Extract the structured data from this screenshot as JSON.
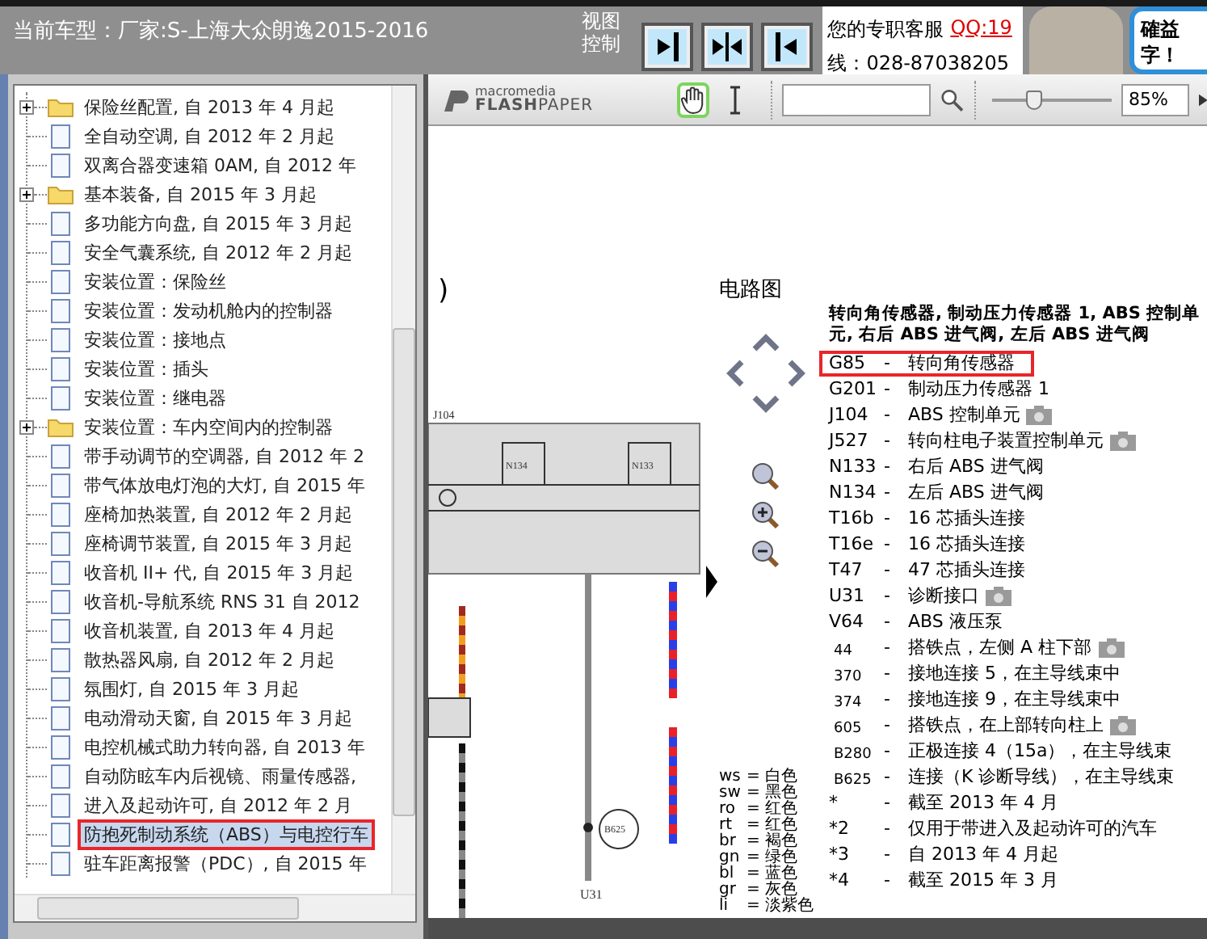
{
  "top_bar": {
    "vehicle": "当前车型：厂家:S-上海大众朗逸2015-2016",
    "view_control_label": "视图控制",
    "view_buttons": [
      {
        "kind": "right"
      },
      {
        "kind": "both"
      },
      {
        "kind": "left"
      }
    ],
    "service": {
      "label": "您的专职客服",
      "qq": "QQ:19",
      "phone": "线：028-87038205"
    },
    "promo": [
      "確益",
      "字！"
    ]
  },
  "tree": {
    "items": [
      {
        "label": "保险丝配置, 自 2013 年 4 月起",
        "kind": "folder",
        "expanded": false,
        "selected": false,
        "highlighted": false
      },
      {
        "label": "全自动空调, 自 2012 年 2 月起",
        "kind": "page",
        "selected": false,
        "highlighted": false
      },
      {
        "label": "双离合器变速箱 0AM, 自 2012 年",
        "kind": "page",
        "selected": false,
        "highlighted": false
      },
      {
        "label": "基本装备, 自 2015 年 3 月起",
        "kind": "folder",
        "expanded": false,
        "selected": false,
        "highlighted": false
      },
      {
        "label": "多功能方向盘, 自 2015 年 3 月起",
        "kind": "page",
        "selected": false,
        "highlighted": false
      },
      {
        "label": "安全气囊系统, 自 2012 年 2 月起",
        "kind": "page",
        "selected": false,
        "highlighted": false
      },
      {
        "label": "安装位置：保险丝",
        "kind": "page",
        "selected": false,
        "highlighted": false
      },
      {
        "label": "安装位置：发动机舱内的控制器",
        "kind": "page",
        "selected": false,
        "highlighted": false
      },
      {
        "label": "安装位置：接地点",
        "kind": "page",
        "selected": false,
        "highlighted": false
      },
      {
        "label": "安装位置：插头",
        "kind": "page",
        "selected": false,
        "highlighted": false
      },
      {
        "label": "安装位置：继电器",
        "kind": "page",
        "selected": false,
        "highlighted": false
      },
      {
        "label": "安装位置：车内空间内的控制器",
        "kind": "folder",
        "expanded": false,
        "selected": false,
        "highlighted": false
      },
      {
        "label": "带手动调节的空调器, 自 2012 年 2",
        "kind": "page",
        "selected": false,
        "highlighted": false
      },
      {
        "label": "带气体放电灯泡的大灯, 自 2015 年",
        "kind": "page",
        "selected": false,
        "highlighted": false
      },
      {
        "label": "座椅加热装置, 自 2012 年 2 月起",
        "kind": "page",
        "selected": false,
        "highlighted": false
      },
      {
        "label": "座椅调节装置, 自 2015 年 3 月起",
        "kind": "page",
        "selected": false,
        "highlighted": false
      },
      {
        "label": "收音机 II+ 代, 自 2015 年 3 月起",
        "kind": "page",
        "selected": false,
        "highlighted": false
      },
      {
        "label": "收音机-导航系统 RNS 31 自 2012",
        "kind": "page",
        "selected": false,
        "highlighted": false
      },
      {
        "label": "收音机装置, 自 2013 年 4 月起",
        "kind": "page",
        "selected": false,
        "highlighted": false
      },
      {
        "label": "散热器风扇, 自 2012 年 2 月起",
        "kind": "page",
        "selected": false,
        "highlighted": false
      },
      {
        "label": "氛围灯, 自 2015 年 3 月起",
        "kind": "page",
        "selected": false,
        "highlighted": false
      },
      {
        "label": "电动滑动天窗, 自 2015 年 3 月起",
        "kind": "page",
        "selected": false,
        "highlighted": false
      },
      {
        "label": "电控机械式助力转向器, 自 2013 年",
        "kind": "page",
        "selected": false,
        "highlighted": false
      },
      {
        "label": "自动防眩车内后视镜、雨量传感器,",
        "kind": "page",
        "selected": false,
        "highlighted": false
      },
      {
        "label": "进入及起动许可, 自 2012 年 2 月",
        "kind": "page",
        "selected": false,
        "highlighted": false
      },
      {
        "label": "防抱死制动系统（ABS）与电控行车",
        "kind": "page",
        "selected": true,
        "highlighted": true
      },
      {
        "label": "驻车距离报警（PDC）, 自 2015 年",
        "kind": "page",
        "selected": false,
        "highlighted": false
      }
    ]
  },
  "viewer": {
    "logo_top": "macromedia",
    "logo": "**FLASH**PAPER",
    "tools": [
      {
        "kind": "hand",
        "selected": true
      },
      {
        "kind": "text",
        "selected": false
      }
    ],
    "zoom": {
      "level": 0.3,
      "value": "85%"
    },
    "page": {
      "bracket": ")",
      "title": "电路图",
      "heading": "转向角传感器, 制动压力传感器 1, ABS 控制单元, 右后 ABS 进气阀, 左后 ABS 进气阀",
      "diagram_labels": [
        "J104",
        "N134",
        "N133",
        "B625",
        "U31"
      ],
      "color_codes": [
        {
          "code": "ws",
          "sep": "=",
          "name": "白色"
        },
        {
          "code": "sw",
          "sep": "=",
          "name": "黑色"
        },
        {
          "code": "ro",
          "sep": "=",
          "name": "红色"
        },
        {
          "code": "rt",
          "sep": "=",
          "name": "红色"
        },
        {
          "code": "br",
          "sep": "=",
          "name": "褐色"
        },
        {
          "code": "gn",
          "sep": "=",
          "name": "绿色"
        },
        {
          "code": "bl",
          "sep": "=",
          "name": "蓝色"
        },
        {
          "code": "gr",
          "sep": "=",
          "name": "灰色"
        },
        {
          "code": "li",
          "sep": "=",
          "name": "淡紫色"
        }
      ],
      "legend": [
        {
          "kind": "part",
          "code": "G85",
          "sep": "-",
          "text": "转向角传感器",
          "camera": false,
          "highlighted": true
        },
        {
          "kind": "part",
          "code": "G201",
          "sep": "-",
          "text": "制动压力传感器 1",
          "camera": false,
          "highlighted": false
        },
        {
          "kind": "part",
          "code": "J104",
          "sep": "-",
          "text": "ABS 控制单元",
          "camera": true,
          "highlighted": false
        },
        {
          "kind": "part",
          "code": "J527",
          "sep": "-",
          "text": "转向柱电子装置控制单元",
          "camera": true,
          "highlighted": false
        },
        {
          "kind": "part",
          "code": "N133",
          "sep": "-",
          "text": "右后 ABS 进气阀",
          "camera": false,
          "highlighted": false
        },
        {
          "kind": "part",
          "code": "N134",
          "sep": "-",
          "text": "左后 ABS 进气阀",
          "camera": false,
          "highlighted": false
        },
        {
          "kind": "part",
          "code": "T16b",
          "sep": "-",
          "text": "16 芯插头连接",
          "camera": false,
          "highlighted": false
        },
        {
          "kind": "part",
          "code": "T16e",
          "sep": "-",
          "text": "16 芯插头连接",
          "camera": false,
          "highlighted": false
        },
        {
          "kind": "part",
          "code": "T47",
          "sep": "-",
          "text": "47 芯插头连接",
          "camera": false,
          "highlighted": false
        },
        {
          "kind": "part",
          "code": "U31",
          "sep": "-",
          "text": "诊断接口",
          "camera": true,
          "highlighted": false
        },
        {
          "kind": "part",
          "code": "V64",
          "sep": "-",
          "text": "ABS 液压泵",
          "camera": false,
          "highlighted": false
        },
        {
          "kind": "point",
          "code": "44",
          "sep": "-",
          "text": "搭铁点，左侧 A 柱下部",
          "camera": true,
          "highlighted": false
        },
        {
          "kind": "point",
          "code": "370",
          "sep": "-",
          "text": "接地连接 5，在主导线束中",
          "camera": false,
          "highlighted": false
        },
        {
          "kind": "point",
          "code": "374",
          "sep": "-",
          "text": "接地连接 9，在主导线束中",
          "camera": false,
          "highlighted": false
        },
        {
          "kind": "point",
          "code": "605",
          "sep": "-",
          "text": "搭铁点，在上部转向柱上",
          "camera": true,
          "highlighted": false
        },
        {
          "kind": "point",
          "code": "B280",
          "sep": "-",
          "text": "正极连接 4（15a），在主导线束",
          "camera": false,
          "highlighted": false
        },
        {
          "kind": "point",
          "code": "B625",
          "sep": "-",
          "text": "连接（K 诊断导线），在主导线束",
          "camera": false,
          "highlighted": false
        },
        {
          "kind": "part",
          "code": "*",
          "sep": "-",
          "text": "截至 2013 年 4 月",
          "camera": false,
          "highlighted": false
        },
        {
          "kind": "part",
          "code": "*2",
          "sep": "-",
          "text": "仅用于带进入及起动许可的汽车",
          "camera": false,
          "highlighted": false
        },
        {
          "kind": "part",
          "code": "*3",
          "sep": "-",
          "text": "自 2013 年 4 月起",
          "camera": false,
          "highlighted": false
        },
        {
          "kind": "part",
          "code": "*4",
          "sep": "-",
          "text": "截至 2015 年 3 月",
          "camera": false,
          "highlighted": false
        }
      ]
    }
  }
}
